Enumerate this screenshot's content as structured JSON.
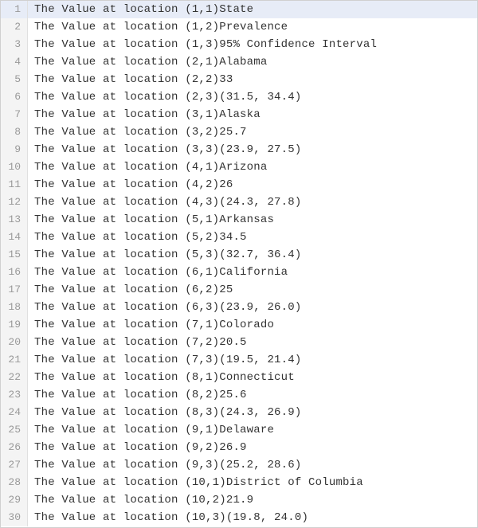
{
  "selected_line": 1,
  "chart_data": {
    "type": "table",
    "columns": [
      "State",
      "Prevalence",
      "95% Confidence Interval"
    ],
    "rows": [
      {
        "state": "Alabama",
        "prevalence": 33,
        "ci": "(31.5, 34.4)"
      },
      {
        "state": "Alaska",
        "prevalence": 25.7,
        "ci": "(23.9, 27.5)"
      },
      {
        "state": "Arizona",
        "prevalence": 26,
        "ci": "(24.3, 27.8)"
      },
      {
        "state": "Arkansas",
        "prevalence": 34.5,
        "ci": "(32.7, 36.4)"
      },
      {
        "state": "California",
        "prevalence": 25,
        "ci": "(23.9, 26.0)"
      },
      {
        "state": "Colorado",
        "prevalence": 20.5,
        "ci": "(19.5, 21.4)"
      },
      {
        "state": "Connecticut",
        "prevalence": 25.6,
        "ci": "(24.3, 26.9)"
      },
      {
        "state": "Delaware",
        "prevalence": 26.9,
        "ci": "(25.2, 28.6)"
      },
      {
        "state": "District of Columbia",
        "prevalence": 21.9,
        "ci": "(19.8, 24.0)"
      }
    ],
    "title": "",
    "xlabel": "",
    "ylabel": ""
  },
  "lines": [
    {
      "n": 1,
      "text": "The Value at location (1,1)State"
    },
    {
      "n": 2,
      "text": "The Value at location (1,2)Prevalence"
    },
    {
      "n": 3,
      "text": "The Value at location (1,3)95% Confidence Interval"
    },
    {
      "n": 4,
      "text": "The Value at location (2,1)Alabama"
    },
    {
      "n": 5,
      "text": "The Value at location (2,2)33"
    },
    {
      "n": 6,
      "text": "The Value at location (2,3)(31.5, 34.4)"
    },
    {
      "n": 7,
      "text": "The Value at location (3,1)Alaska"
    },
    {
      "n": 8,
      "text": "The Value at location (3,2)25.7"
    },
    {
      "n": 9,
      "text": "The Value at location (3,3)(23.9, 27.5)"
    },
    {
      "n": 10,
      "text": "The Value at location (4,1)Arizona"
    },
    {
      "n": 11,
      "text": "The Value at location (4,2)26"
    },
    {
      "n": 12,
      "text": "The Value at location (4,3)(24.3, 27.8)"
    },
    {
      "n": 13,
      "text": "The Value at location (5,1)Arkansas"
    },
    {
      "n": 14,
      "text": "The Value at location (5,2)34.5"
    },
    {
      "n": 15,
      "text": "The Value at location (5,3)(32.7, 36.4)"
    },
    {
      "n": 16,
      "text": "The Value at location (6,1)California"
    },
    {
      "n": 17,
      "text": "The Value at location (6,2)25"
    },
    {
      "n": 18,
      "text": "The Value at location (6,3)(23.9, 26.0)"
    },
    {
      "n": 19,
      "text": "The Value at location (7,1)Colorado"
    },
    {
      "n": 20,
      "text": "The Value at location (7,2)20.5"
    },
    {
      "n": 21,
      "text": "The Value at location (7,3)(19.5, 21.4)"
    },
    {
      "n": 22,
      "text": "The Value at location (8,1)Connecticut"
    },
    {
      "n": 23,
      "text": "The Value at location (8,2)25.6"
    },
    {
      "n": 24,
      "text": "The Value at location (8,3)(24.3, 26.9)"
    },
    {
      "n": 25,
      "text": "The Value at location (9,1)Delaware"
    },
    {
      "n": 26,
      "text": "The Value at location (9,2)26.9"
    },
    {
      "n": 27,
      "text": "The Value at location (9,3)(25.2, 28.6)"
    },
    {
      "n": 28,
      "text": "The Value at location (10,1)District of Columbia"
    },
    {
      "n": 29,
      "text": "The Value at location (10,2)21.9"
    },
    {
      "n": 30,
      "text": "The Value at location (10,3)(19.8, 24.0)"
    }
  ]
}
